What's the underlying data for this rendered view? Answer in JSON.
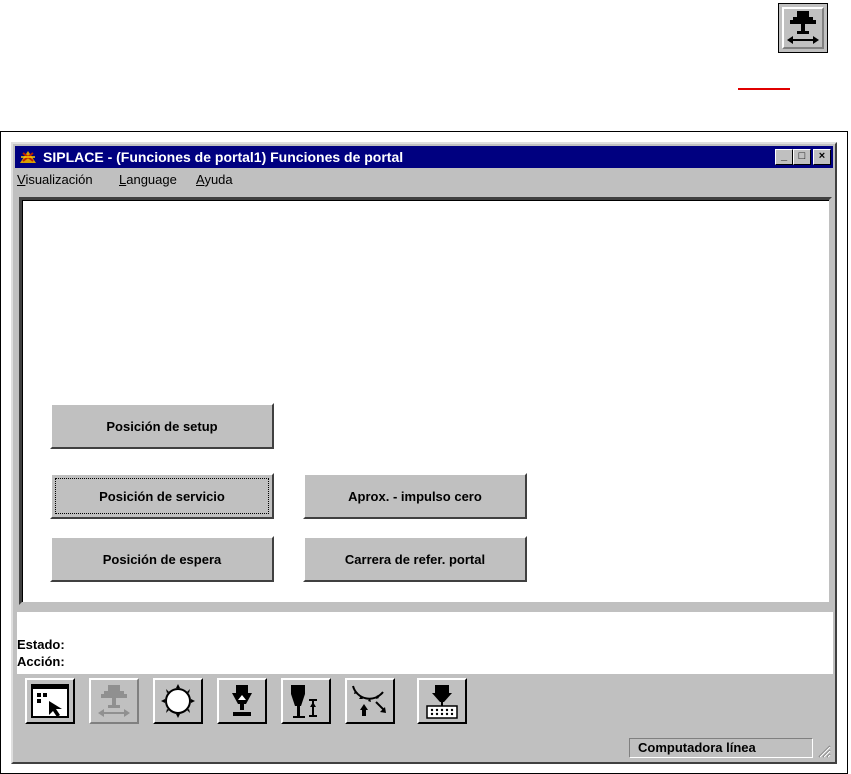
{
  "window": {
    "title": "SIPLACE - (Funciones de portal1) Funciones de portal",
    "minimize": "_",
    "maximize": "□",
    "close": "×"
  },
  "menu": {
    "items": [
      {
        "first": "V",
        "rest": "isualización"
      },
      {
        "first": "L",
        "rest": "anguage"
      },
      {
        "first": "A",
        "rest": "yuda"
      }
    ]
  },
  "buttons": {
    "setup": "Posición de setup",
    "service": "Posición de servicio",
    "standby": "Posición de espera",
    "zero_pulse": "Aprox. - impulso cero",
    "reference_run": "Carrera de refer. portal"
  },
  "status": {
    "estado_label": "Estado:",
    "accion_label": "Acción:"
  },
  "statusbar": {
    "mode": "Computadora línea"
  },
  "toolbar": {
    "icons": [
      "select-arrow-icon",
      "gantry-icon",
      "star-wheel-icon",
      "nozzle-up-icon",
      "nozzle-height-icon",
      "pickup-rotate-icon",
      "feeder-table-icon"
    ]
  },
  "colors": {
    "titlebar": "#000080",
    "face": "#c0c0c0",
    "accent_red": "#e00000"
  }
}
